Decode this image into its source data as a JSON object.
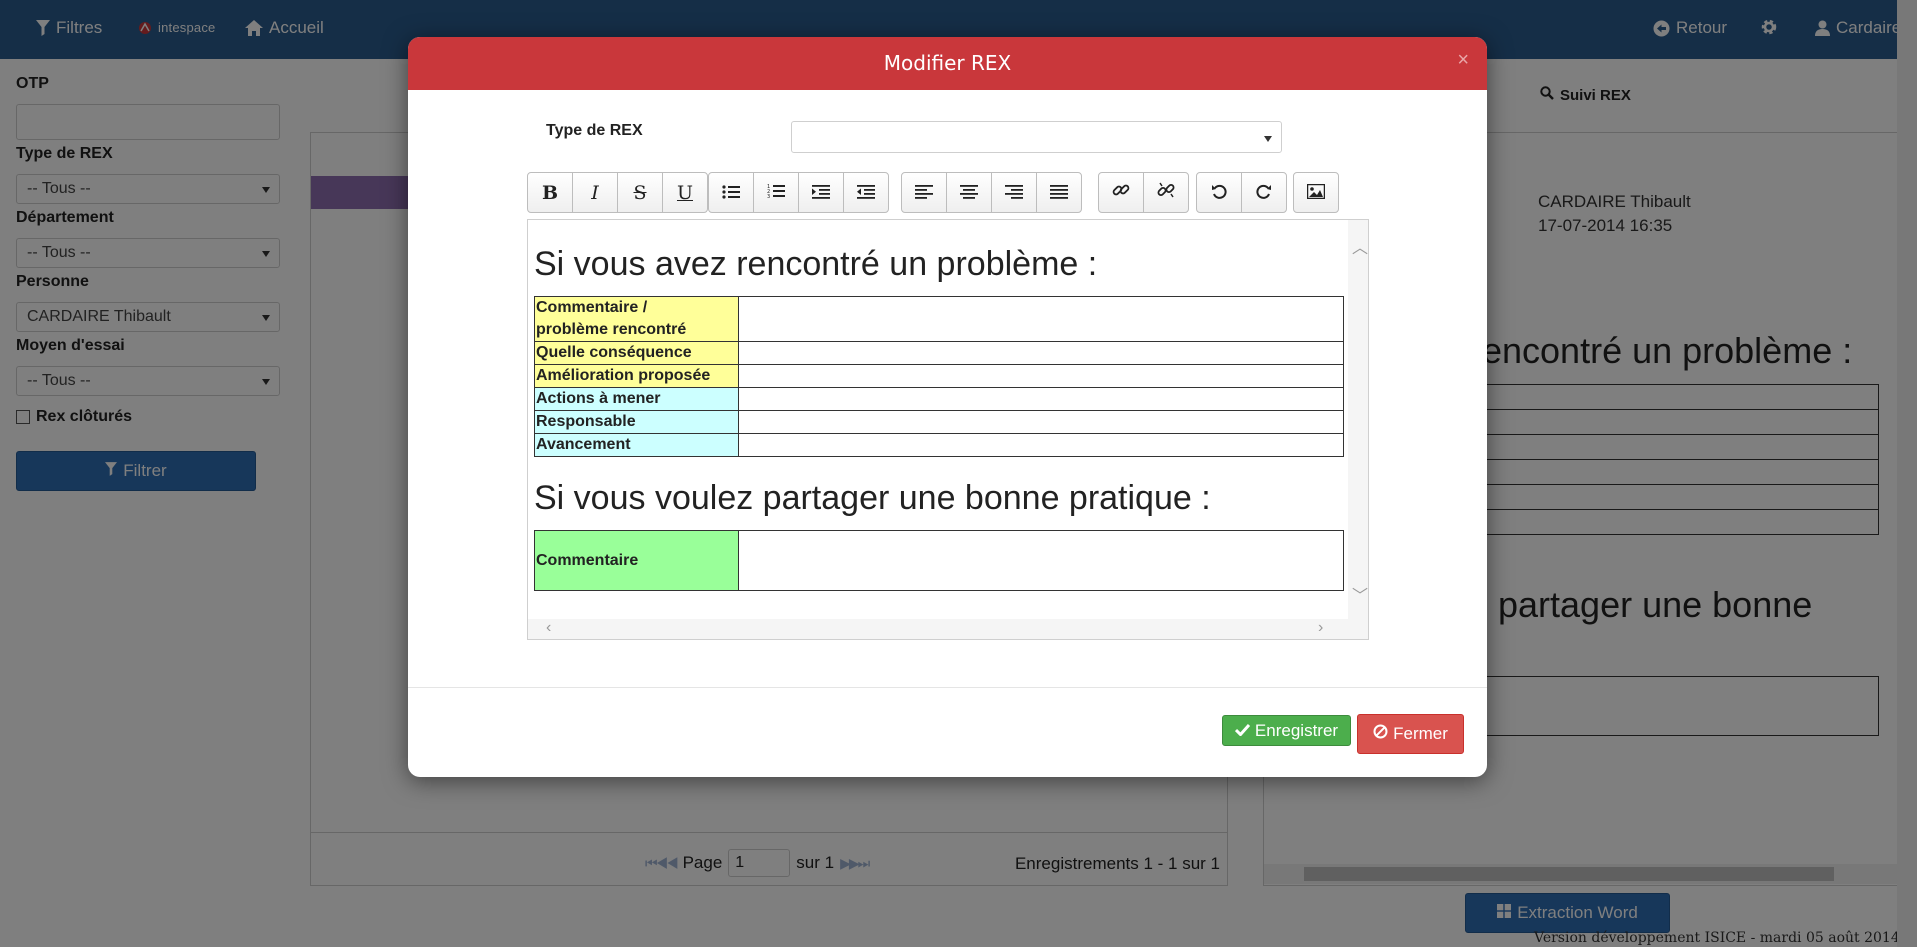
{
  "navbar": {
    "filters_label": "Filtres",
    "logo_text": "intespace",
    "home_label": "Accueil",
    "back_label": "Retour",
    "user_label": "Cardaire"
  },
  "sidebar": {
    "otp_label": "OTP",
    "otp_value": "",
    "type_label": "Type de REX",
    "type_value": "-- Tous --",
    "dept_label": "Département",
    "dept_value": "-- Tous --",
    "person_label": "Personne",
    "person_value": "CARDAIRE Thibault",
    "moyen_label": "Moyen d'essai",
    "moyen_value": "-- Tous --",
    "closed_label": "Rex clôturés",
    "filter_button": "Filtrer"
  },
  "pager": {
    "page_label": "Page",
    "page_value": "1",
    "of_label": "sur 1",
    "records": "Enregistrements 1 - 1 sur 1"
  },
  "right_panel": {
    "tab_label": "Suivi REX",
    "author": "CARDAIRE Thibault",
    "date": "17-07-2014 16:35",
    "heading1_partial": "rencontré un problème :",
    "heading2_partial": "z partager une bonne",
    "word_button": "Extraction Word",
    "version": "Version développement ISICE - mardi 05 août 2014"
  },
  "modal": {
    "title": "Modifier REX",
    "close_glyph": "×",
    "type_label": "Type de REX",
    "type_value": "",
    "toolbar": {
      "bold": "B",
      "italic": "I",
      "strike": "S",
      "underline": "U"
    },
    "editor": {
      "heading1": "Si vous avez rencontré un problème :",
      "problem_rows": [
        {
          "label": "Commentaire /",
          "label2": "problème rencontré"
        },
        {
          "label": "Quelle conséquence"
        },
        {
          "label": "Amélioration proposée"
        },
        {
          "label": "Actions à mener"
        },
        {
          "label": "Responsable"
        },
        {
          "label": "Avancement"
        }
      ],
      "heading2": "Si vous voulez partager une bonne pratique :",
      "practice_label": "Commentaire"
    },
    "save_button": "Enregistrer",
    "close_button": "Fermer"
  },
  "colors": {
    "navbar": "#2a5d8f",
    "modal_header": "#c9373b",
    "primary_button": "#2f6eb5",
    "save_button": "#4cae4c",
    "close_button": "#d9534f",
    "cell_yellow": "#ffff99",
    "cell_cyan": "#ccffff",
    "cell_green": "#99ff99"
  }
}
